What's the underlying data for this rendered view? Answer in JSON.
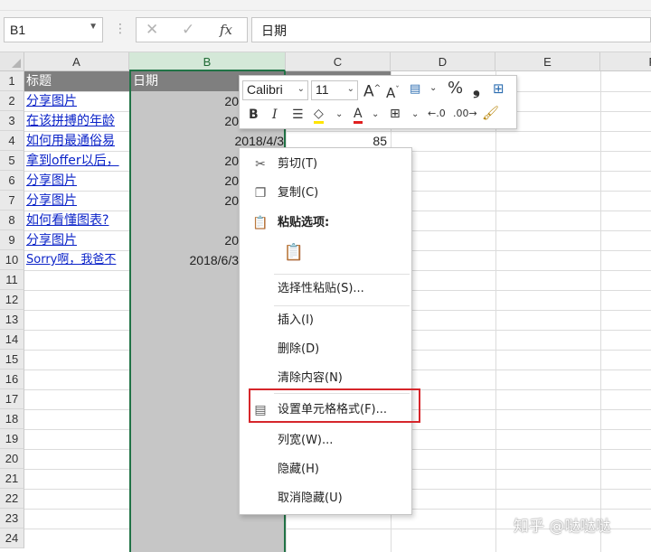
{
  "formula_bar": {
    "cell_ref": "B1",
    "fx": "fx",
    "content": "日期"
  },
  "columns": [
    "A",
    "B",
    "C",
    "D",
    "E",
    "F"
  ],
  "rows": [
    "1",
    "2",
    "3",
    "4",
    "5",
    "6",
    "7",
    "8",
    "9",
    "10",
    "11",
    "12",
    "13",
    "14",
    "15",
    "16",
    "17",
    "18",
    "19",
    "20",
    "21",
    "22",
    "23",
    "24"
  ],
  "cells": {
    "a1": "标题",
    "b1": "日期",
    "a2": "分享图片",
    "a3": "在该拼搏的年龄",
    "a4": "如何用最通俗易",
    "a5": "拿到offer以后，",
    "a6": "分享图片",
    "a7": "分享图片",
    "a8": "如何看懂图表?",
    "a9": "分享图片",
    "a10": "Sorry啊，我爸不",
    "b2": "20",
    "b3": "20",
    "b4": "2018/4/3",
    "b5": "20",
    "b6": "20",
    "b7": "20",
    "b9": "20",
    "b10": "2018/6/3",
    "c4": "85"
  },
  "mini_toolbar": {
    "font": "Calibri",
    "size": "11",
    "bold": "B",
    "italic": "I",
    "percent": "%",
    "comma": "❟",
    "grow": "A",
    "shrink": "A",
    "font_color": "A"
  },
  "menu": {
    "cut": "剪切(T)",
    "copy": "复制(C)",
    "paste_options": "粘贴选项:",
    "paste_special": "选择性粘贴(S)...",
    "insert": "插入(I)",
    "delete": "删除(D)",
    "clear": "清除内容(N)",
    "format_cells": "设置单元格格式(F)...",
    "col_width": "列宽(W)...",
    "hide": "隐藏(H)",
    "unhide": "取消隐藏(U)"
  },
  "watermark": "知乎 @哒哒哒",
  "colors": {
    "header_fill": "#7f7f7f",
    "selected_column": "#c6c6c6",
    "selection_border": "#217346",
    "link": "#0b23c8",
    "highlight": "#d6262b"
  }
}
